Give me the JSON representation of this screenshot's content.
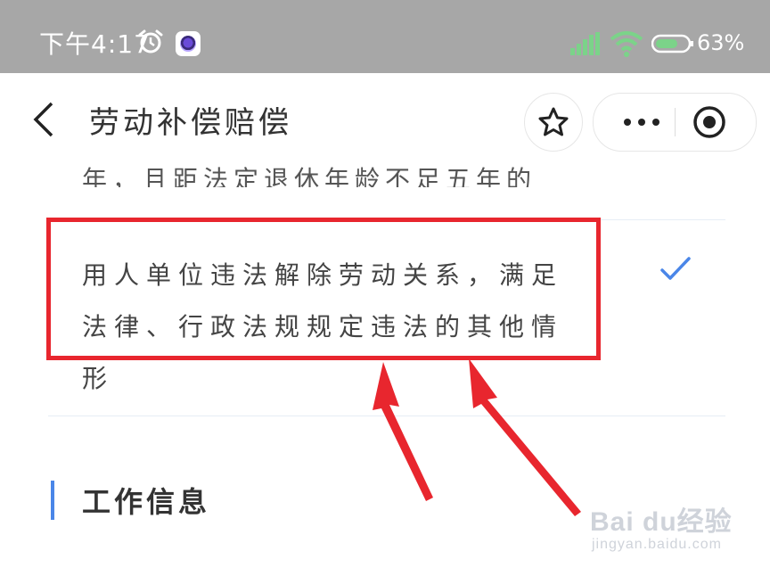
{
  "status_bar": {
    "time": "下午4:17",
    "battery_level": "63%",
    "colors": {
      "background": "#a7a7a7",
      "foreground": "#ffffff"
    },
    "icons": [
      "alarm-clock-icon",
      "app-notification-icon",
      "signal-icon",
      "wifi-icon",
      "battery-icon"
    ]
  },
  "nav": {
    "title": "劳动补偿赔偿",
    "icons": [
      "chevron-left-icon",
      "star-icon",
      "more-dots-icon",
      "close-circle-icon"
    ]
  },
  "content": {
    "previous_option_partial": "年，且距法定退休年龄不足五年的",
    "selected_option": {
      "text": "用人单位违法解除劳动关系，满足法律、行政法规规定违法的其他情形",
      "checked": true
    },
    "section_title": "工作信息"
  },
  "annotation": {
    "highlight_color": "#e8262e",
    "arrow_count": 2
  },
  "watermark": {
    "logo": "Bai du经验",
    "url": "jingyan.baidu.com"
  },
  "colors": {
    "accent": "#4a86e8",
    "divider": "#e6edf5",
    "text": "#333333"
  }
}
